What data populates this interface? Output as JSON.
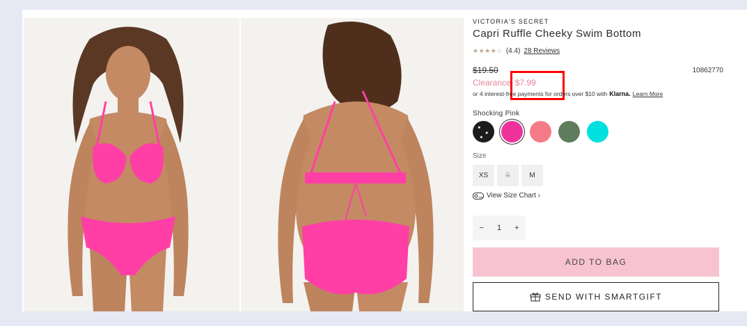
{
  "product": {
    "brand": "VICTORIA'S SECRET",
    "title": "Capri Ruffle Cheeky Swim Bottom",
    "stars": "★★★★☆",
    "rating": "(4.4)",
    "reviews": "28 Reviews",
    "original_price": "$19.50",
    "sku": "10862770",
    "clearance_label": "Clearance",
    "sale_price": "$7.99"
  },
  "klarna": {
    "text_before": "or 4 interest-free payments for orders over $10 with",
    "logo": "Klarna.",
    "learn_more": "Learn More"
  },
  "color": {
    "selected_name": "Shocking Pink",
    "swatches": [
      {
        "name": "black-print",
        "color": "#1c1c1c"
      },
      {
        "name": "shocking-pink",
        "color": "#f0339c"
      },
      {
        "name": "coral-pink",
        "color": "#f57a88"
      },
      {
        "name": "green",
        "color": "#5e7d5c"
      },
      {
        "name": "cyan",
        "color": "#00e0df"
      }
    ]
  },
  "size": {
    "label": "Size",
    "options": [
      "XS",
      "S",
      "M"
    ]
  },
  "size_chart": "View Size Chart ›",
  "quantity": {
    "minus": "−",
    "value": "1",
    "plus": "+"
  },
  "buttons": {
    "add_to_bag": "ADD TO BAG",
    "smartgift": "SEND WITH SMARTGIFT"
  }
}
